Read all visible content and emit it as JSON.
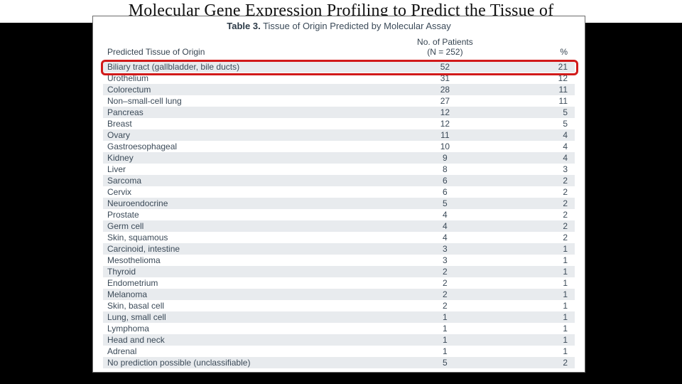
{
  "page_title": "Molecular Gene Expression Profiling to Predict the Tissue of",
  "table": {
    "label_prefix": "Table 3.",
    "title": "Tissue of Origin Predicted by Molecular Assay",
    "headers": {
      "tissue": "Predicted Tissue of Origin",
      "n_line1": "No. of Patients",
      "n_line2": "(N = 252)",
      "pct": "%"
    },
    "rows": [
      {
        "tissue": "Biliary tract (gallbladder, bile ducts)",
        "n": "52",
        "pct": "21"
      },
      {
        "tissue": "Urothelium",
        "n": "31",
        "pct": "12"
      },
      {
        "tissue": "Colorectum",
        "n": "28",
        "pct": "11"
      },
      {
        "tissue": "Non–small-cell lung",
        "n": "27",
        "pct": "11"
      },
      {
        "tissue": "Pancreas",
        "n": "12",
        "pct": "5"
      },
      {
        "tissue": "Breast",
        "n": "12",
        "pct": "5"
      },
      {
        "tissue": "Ovary",
        "n": "11",
        "pct": "4"
      },
      {
        "tissue": "Gastroesophageal",
        "n": "10",
        "pct": "4"
      },
      {
        "tissue": "Kidney",
        "n": "9",
        "pct": "4"
      },
      {
        "tissue": "Liver",
        "n": "8",
        "pct": "3"
      },
      {
        "tissue": "Sarcoma",
        "n": "6",
        "pct": "2"
      },
      {
        "tissue": "Cervix",
        "n": "6",
        "pct": "2"
      },
      {
        "tissue": "Neuroendocrine",
        "n": "5",
        "pct": "2"
      },
      {
        "tissue": "Prostate",
        "n": "4",
        "pct": "2"
      },
      {
        "tissue": "Germ cell",
        "n": "4",
        "pct": "2"
      },
      {
        "tissue": "Skin, squamous",
        "n": "4",
        "pct": "2"
      },
      {
        "tissue": "Carcinoid, intestine",
        "n": "3",
        "pct": "1"
      },
      {
        "tissue": "Mesothelioma",
        "n": "3",
        "pct": "1"
      },
      {
        "tissue": "Thyroid",
        "n": "2",
        "pct": "1"
      },
      {
        "tissue": "Endometrium",
        "n": "2",
        "pct": "1"
      },
      {
        "tissue": "Melanoma",
        "n": "2",
        "pct": "1"
      },
      {
        "tissue": "Skin, basal cell",
        "n": "2",
        "pct": "1"
      },
      {
        "tissue": "Lung, small cell",
        "n": "1",
        "pct": "1"
      },
      {
        "tissue": "Lymphoma",
        "n": "1",
        "pct": "1"
      },
      {
        "tissue": "Head and neck",
        "n": "1",
        "pct": "1"
      },
      {
        "tissue": "Adrenal",
        "n": "1",
        "pct": "1"
      },
      {
        "tissue": "No prediction possible (unclassifiable)",
        "n": "5",
        "pct": "2"
      }
    ],
    "highlight_row_index": 0
  },
  "colors": {
    "highlight_border": "#d11a1a",
    "row_stripe": "#e8ebee",
    "text": "#3b4a58"
  }
}
